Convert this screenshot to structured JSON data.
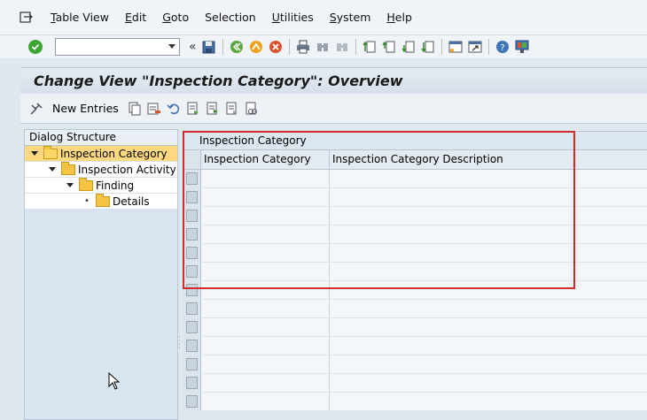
{
  "menubar": {
    "items": [
      {
        "label": "Table View",
        "u": "T",
        "rest": "able View"
      },
      {
        "label": "Edit",
        "u": "E",
        "rest": "dit"
      },
      {
        "label": "Goto",
        "u": "G",
        "rest": "oto"
      },
      {
        "label": "Selection",
        "u": "",
        "rest": "Selection"
      },
      {
        "label": "Utilities",
        "u": "U",
        "rest": "tilities"
      },
      {
        "label": "System",
        "u": "S",
        "rest": "ystem"
      },
      {
        "label": "Help",
        "u": "H",
        "rest": "elp"
      }
    ]
  },
  "toolbar": {
    "command_value": "",
    "chevron": "«"
  },
  "title": "Change View \"Inspection Category\": Overview",
  "app_toolbar": {
    "new_entries_label": "New Entries"
  },
  "dialog_structure": {
    "header": "Dialog Structure",
    "items": [
      {
        "label": "Inspection Category"
      },
      {
        "label": "Inspection Activity"
      },
      {
        "label": "Finding"
      },
      {
        "label": "Details"
      }
    ]
  },
  "table": {
    "caption": "Inspection Category",
    "columns": [
      "Inspection Category",
      "Inspection Category Description"
    ],
    "rows": [
      "",
      "",
      "",
      "",
      "",
      "",
      "",
      "",
      "",
      "",
      "",
      "",
      ""
    ]
  },
  "colors": {
    "highlight": "#d32a2a",
    "selected_tree": "#fcd981",
    "panel": "#d8e4ef"
  }
}
